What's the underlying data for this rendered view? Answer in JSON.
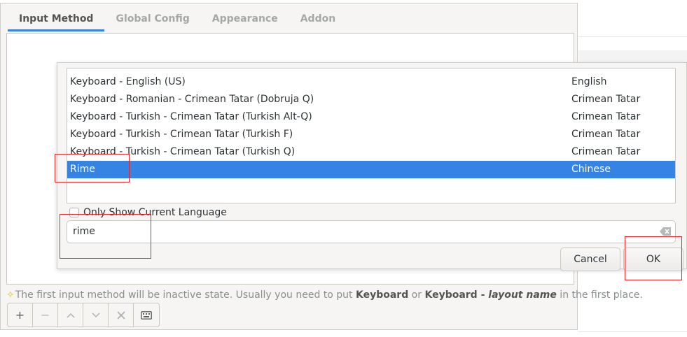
{
  "tabs": [
    {
      "label": "Input Method",
      "active": true
    },
    {
      "label": "Global Config",
      "active": false
    },
    {
      "label": "Appearance",
      "active": false
    },
    {
      "label": "Addon",
      "active": false
    }
  ],
  "hint": {
    "prefix": "The first input method will be inactive state. Usually you need to put ",
    "kw1": "Keyboard",
    "mid": " or ",
    "kw2": "Keyboard - ",
    "kw2_italic": "layout name",
    "suffix": " in the first place."
  },
  "toolbar": {
    "add": "+",
    "remove": "−",
    "up": "⌃",
    "down": "⌄",
    "configure": "✲",
    "keyboard": "⌨"
  },
  "dialog": {
    "rows": [
      {
        "name": "Keyboard - English (US)",
        "language": "English",
        "selected": false
      },
      {
        "name": "Keyboard - Romanian - Crimean Tatar (Dobruja Q)",
        "language": "Crimean Tatar",
        "selected": false
      },
      {
        "name": "Keyboard - Turkish - Crimean Tatar (Turkish Alt-Q)",
        "language": "Crimean Tatar",
        "selected": false
      },
      {
        "name": "Keyboard - Turkish - Crimean Tatar (Turkish F)",
        "language": "Crimean Tatar",
        "selected": false
      },
      {
        "name": "Keyboard - Turkish - Crimean Tatar (Turkish Q)",
        "language": "Crimean Tatar",
        "selected": false
      },
      {
        "name": "Rime",
        "language": "Chinese",
        "selected": true
      }
    ],
    "only_current_language_label": "Only Show Current Language",
    "only_current_language_checked": false,
    "search_value": "rime",
    "cancel_label": "Cancel",
    "ok_label": "OK"
  },
  "colors": {
    "accent": "#3584e4",
    "annotation": "#e0262b"
  }
}
